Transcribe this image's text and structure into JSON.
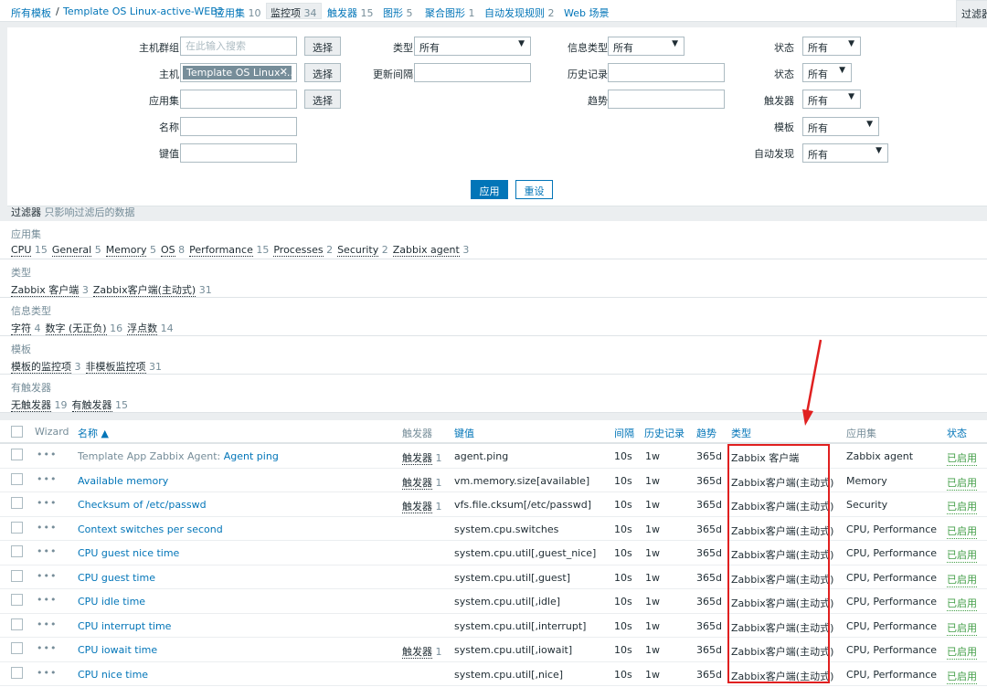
{
  "breadcrumb": {
    "all_templates": "所有模板",
    "separator": "/",
    "template_name": "Template OS Linux-active-WEB2",
    "tabs": [
      {
        "label": "应用集",
        "count": "10"
      },
      {
        "label": "监控项",
        "count": "34"
      },
      {
        "label": "触发器",
        "count": "15"
      },
      {
        "label": "图形",
        "count": "5"
      },
      {
        "label": "聚合图形",
        "count": "1"
      },
      {
        "label": "自动发现规则",
        "count": "2"
      },
      {
        "label": "Web 场景",
        "count": ""
      }
    ],
    "filter_tab": "过滤器"
  },
  "filter": {
    "host_group_label": "主机群组",
    "host_group_placeholder": "在此输入搜索",
    "host_label": "主机",
    "host_chip": "Template OS Linux-...",
    "application_label": "应用集",
    "name_label": "名称",
    "key_label": "键值",
    "select_button": "选择",
    "type_label": "类型",
    "type_value": "所有",
    "update_interval_label": "更新间隔",
    "info_type_label": "信息类型",
    "info_type_value": "所有",
    "history_label": "历史记录",
    "trends_label": "趋势",
    "state_label": "状态",
    "state_value": "所有",
    "status_label": "状态",
    "status_value": "所有",
    "triggers_label": "触发器",
    "triggers_value": "所有",
    "template_label": "模板",
    "template_value": "所有",
    "discovery_label": "自动发现",
    "discovery_value": "所有",
    "apply_button": "应用",
    "reset_button": "重设"
  },
  "subfilter": {
    "title": "过滤器",
    "note": "只影响过滤后的数据",
    "groups": [
      {
        "header": "应用集",
        "items": [
          {
            "label": "CPU",
            "count": "15"
          },
          {
            "label": "General",
            "count": "5"
          },
          {
            "label": "Memory",
            "count": "5"
          },
          {
            "label": "OS",
            "count": "8"
          },
          {
            "label": "Performance",
            "count": "15"
          },
          {
            "label": "Processes",
            "count": "2"
          },
          {
            "label": "Security",
            "count": "2"
          },
          {
            "label": "Zabbix agent",
            "count": "3"
          }
        ]
      },
      {
        "header": "类型",
        "items": [
          {
            "label": "Zabbix 客户端",
            "count": "3"
          },
          {
            "label": "Zabbix客户端(主动式)",
            "count": "31"
          }
        ]
      },
      {
        "header": "信息类型",
        "items": [
          {
            "label": "字符",
            "count": "4"
          },
          {
            "label": "数字 (无正负)",
            "count": "16"
          },
          {
            "label": "浮点数",
            "count": "14"
          }
        ]
      },
      {
        "header": "模板",
        "items": [
          {
            "label": "模板的监控项",
            "count": "3"
          },
          {
            "label": "非模板监控项",
            "count": "31"
          }
        ]
      },
      {
        "header": "有触发器",
        "items": [
          {
            "label": "无触发器",
            "count": "19"
          },
          {
            "label": "有触发器",
            "count": "15"
          }
        ]
      }
    ]
  },
  "table": {
    "headers": {
      "wizard": "Wizard",
      "name": "名称 ▲",
      "triggers": "触发器",
      "key": "键值",
      "interval": "间隔",
      "history": "历史记录",
      "trends": "趋势",
      "type": "类型",
      "applications": "应用集",
      "status": "状态"
    },
    "rows": [
      {
        "template": "Template App Zabbix Agent:",
        "name": "Agent ping",
        "triggers": "触发器",
        "trig_count": "1",
        "key": "agent.ping",
        "interval": "10s",
        "history": "1w",
        "trends": "365d",
        "type": "Zabbix 客户端",
        "applications": "Zabbix agent",
        "status": "已启用"
      },
      {
        "template": "",
        "name": "Available memory",
        "triggers": "触发器",
        "trig_count": "1",
        "key": "vm.memory.size[available]",
        "interval": "10s",
        "history": "1w",
        "trends": "365d",
        "type": "Zabbix客户端(主动式)",
        "applications": "Memory",
        "status": "已启用"
      },
      {
        "template": "",
        "name": "Checksum of /etc/passwd",
        "triggers": "触发器",
        "trig_count": "1",
        "key": "vfs.file.cksum[/etc/passwd]",
        "interval": "10s",
        "history": "1w",
        "trends": "365d",
        "type": "Zabbix客户端(主动式)",
        "applications": "Security",
        "status": "已启用"
      },
      {
        "template": "",
        "name": "Context switches per second",
        "triggers": "",
        "trig_count": "",
        "key": "system.cpu.switches",
        "interval": "10s",
        "history": "1w",
        "trends": "365d",
        "type": "Zabbix客户端(主动式)",
        "applications": "CPU, Performance",
        "status": "已启用"
      },
      {
        "template": "",
        "name": "CPU guest nice time",
        "triggers": "",
        "trig_count": "",
        "key": "system.cpu.util[,guest_nice]",
        "interval": "10s",
        "history": "1w",
        "trends": "365d",
        "type": "Zabbix客户端(主动式)",
        "applications": "CPU, Performance",
        "status": "已启用"
      },
      {
        "template": "",
        "name": "CPU guest time",
        "triggers": "",
        "trig_count": "",
        "key": "system.cpu.util[,guest]",
        "interval": "10s",
        "history": "1w",
        "trends": "365d",
        "type": "Zabbix客户端(主动式)",
        "applications": "CPU, Performance",
        "status": "已启用"
      },
      {
        "template": "",
        "name": "CPU idle time",
        "triggers": "",
        "trig_count": "",
        "key": "system.cpu.util[,idle]",
        "interval": "10s",
        "history": "1w",
        "trends": "365d",
        "type": "Zabbix客户端(主动式)",
        "applications": "CPU, Performance",
        "status": "已启用"
      },
      {
        "template": "",
        "name": "CPU interrupt time",
        "triggers": "",
        "trig_count": "",
        "key": "system.cpu.util[,interrupt]",
        "interval": "10s",
        "history": "1w",
        "trends": "365d",
        "type": "Zabbix客户端(主动式)",
        "applications": "CPU, Performance",
        "status": "已启用"
      },
      {
        "template": "",
        "name": "CPU iowait time",
        "triggers": "触发器",
        "trig_count": "1",
        "key": "system.cpu.util[,iowait]",
        "interval": "10s",
        "history": "1w",
        "trends": "365d",
        "type": "Zabbix客户端(主动式)",
        "applications": "CPU, Performance",
        "status": "已启用"
      },
      {
        "template": "",
        "name": "CPU nice time",
        "triggers": "",
        "trig_count": "",
        "key": "system.cpu.util[,nice]",
        "interval": "10s",
        "history": "1w",
        "trends": "365d",
        "type": "Zabbix客户端(主动式)",
        "applications": "CPU, Performance",
        "status": "已启用"
      }
    ]
  },
  "colors": {
    "link": "#0275b8",
    "enabled": "#429e47",
    "annotation": "#e02020"
  }
}
